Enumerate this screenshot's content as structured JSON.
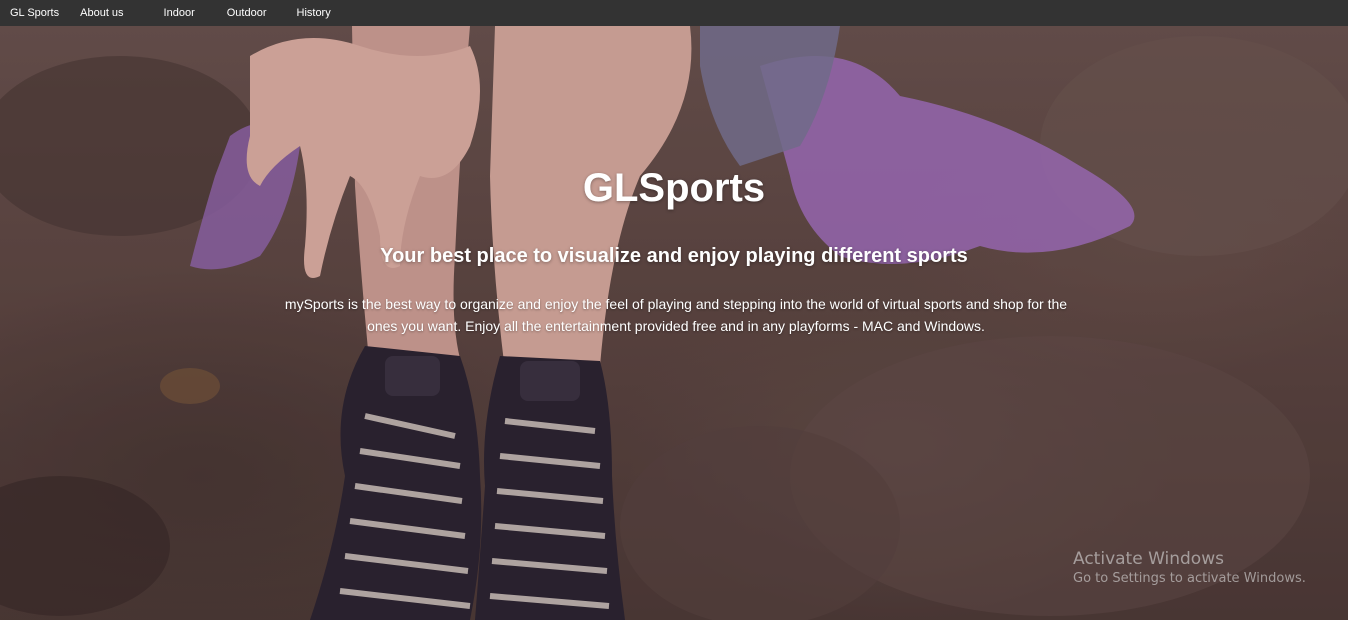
{
  "nav": {
    "brand": "GL Sports",
    "links": [
      "About us",
      "Indoor",
      "Outdoor",
      "History"
    ]
  },
  "hero": {
    "title": "GLSports",
    "subtitle": "Your best place to visualize and enjoy playing different sports",
    "description": "mySports is the best way to organize and enjoy the feel of playing and stepping into the world of virtual sports and shop for the ones you want. Enjoy all the entertainment provided free and in any playforms - MAC and Windows."
  },
  "watermark": {
    "title": "Activate Windows",
    "subtitle": "Go to Settings to activate Windows."
  },
  "colors": {
    "navbar_bg": "#333333",
    "nav_text": "#ffffff",
    "hero_text": "#ffffff",
    "cloth_accent": "#a874c8"
  }
}
